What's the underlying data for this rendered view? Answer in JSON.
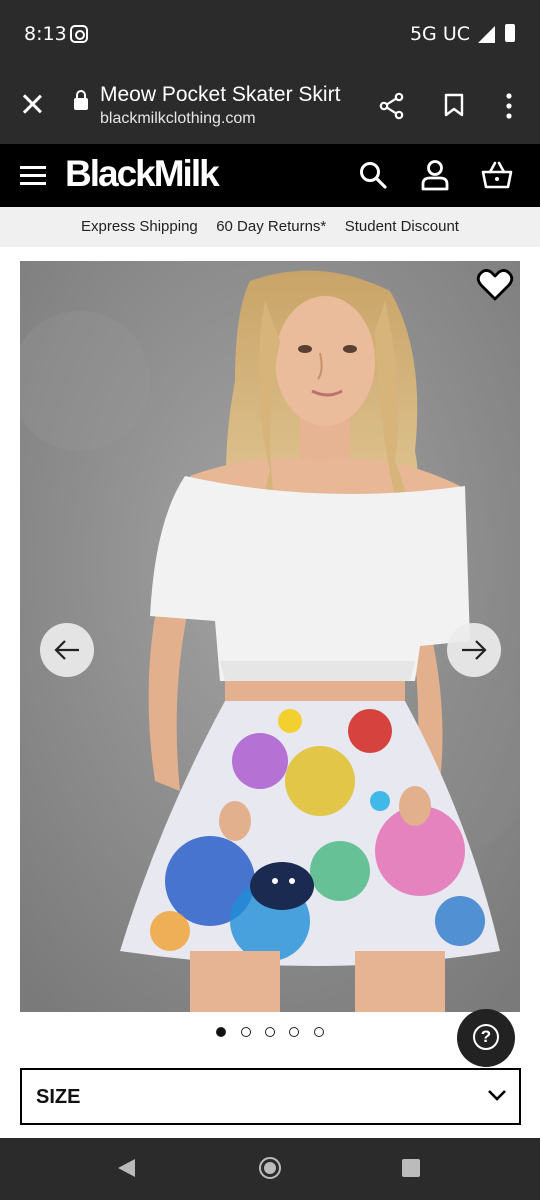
{
  "status_bar": {
    "time": "8:13",
    "network": "5G UC",
    "icons": [
      "instagram-icon",
      "signal-icon",
      "battery-icon"
    ]
  },
  "browser": {
    "title": "Meow Pocket Skater Skirt",
    "url": "blackmilkclothing.com"
  },
  "site_header": {
    "logo": "BlackMilk",
    "icons": [
      "hamburger-icon",
      "search-icon",
      "account-icon",
      "basket-icon"
    ]
  },
  "usp_bar": {
    "items": [
      "Express Shipping",
      "60 Day Returns*",
      "Student Discount"
    ]
  },
  "product_gallery": {
    "image_count": 5,
    "active_index": 1,
    "wishlisted": false
  },
  "size_select": {
    "label": "SIZE"
  },
  "help_button": {
    "label": "?"
  },
  "colors": {
    "header_bg": "#000000",
    "browser_bg": "#2b2b2b",
    "usp_bg": "#f0f0f0"
  }
}
